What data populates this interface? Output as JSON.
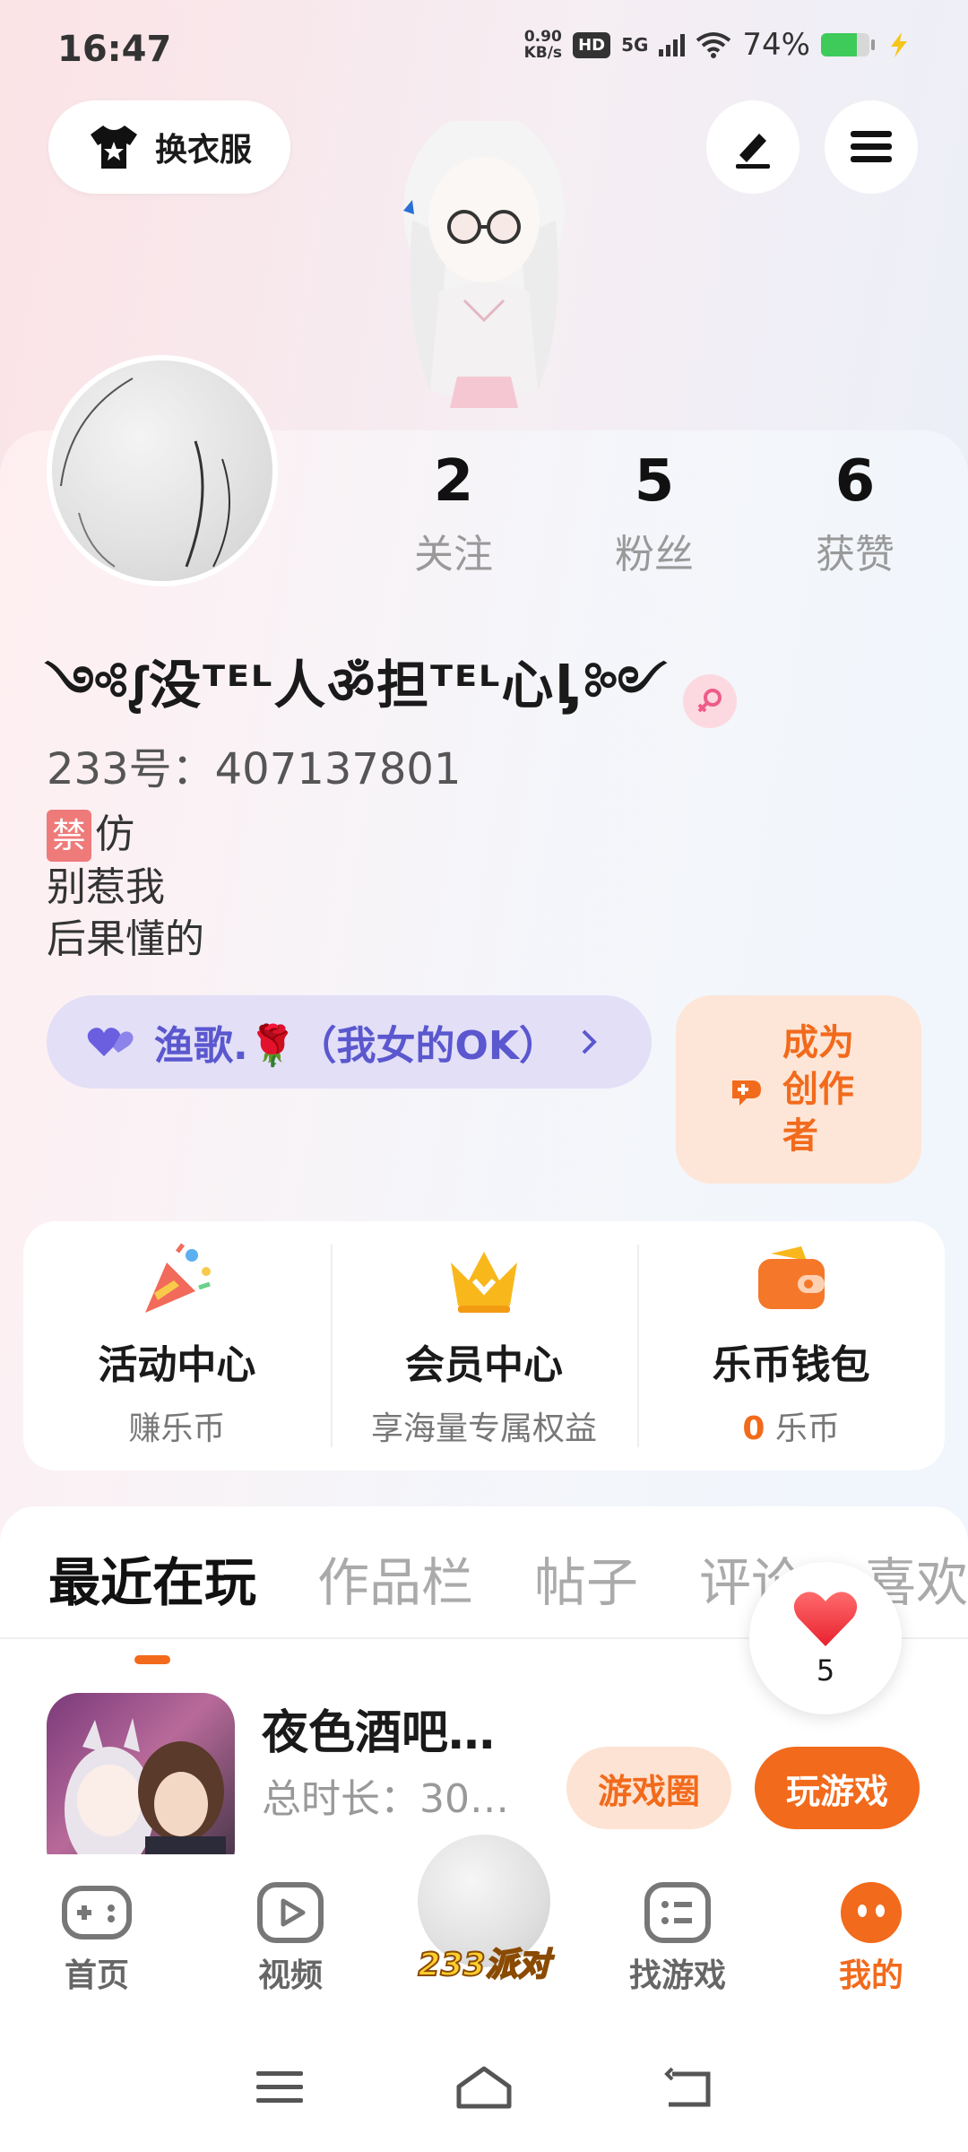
{
  "status_bar": {
    "time": "16:47",
    "speed_value": "0.90",
    "speed_unit": "KB/s",
    "hd": "HD",
    "network": "5G",
    "battery_percent": "74%",
    "battery_level": 0.74
  },
  "header": {
    "outfit_label": "换衣服"
  },
  "profile": {
    "stats": [
      {
        "value": "2",
        "label": "关注"
      },
      {
        "value": "5",
        "label": "粉丝"
      },
      {
        "value": "6",
        "label": "获赞"
      }
    ],
    "nickname": "༺ᶘ没ᵀᴱᴸ人ॐ担ᵀᴱᴸ心ᶅ༻",
    "uid": "233号：407137801",
    "bio_badge": "禁",
    "bio_lines": [
      "仿",
      "别惹我",
      "后果懂的"
    ]
  },
  "family": {
    "label": "渔歌.🌹（我女的OK）"
  },
  "creator": {
    "label": "成为创作者"
  },
  "services": [
    {
      "title": "活动中心",
      "sub": "赚乐币"
    },
    {
      "title": "会员中心",
      "sub": "享海量专属权益"
    },
    {
      "title": "乐币钱包",
      "sub_value": "0",
      "sub_unit": "乐币"
    }
  ],
  "tabs": [
    "最近在玩",
    "作品栏",
    "帖子",
    "评论",
    "喜欢"
  ],
  "like_bubble": {
    "count": "5"
  },
  "recent_game": {
    "title": "夜色酒吧…",
    "duration": "总时长：30…",
    "circle_btn": "游戏圈",
    "play_btn": "玩游戏"
  },
  "bottom_nav": [
    {
      "label": "首页"
    },
    {
      "label": "视频"
    },
    {
      "label": "233派对"
    },
    {
      "label": "找游戏"
    },
    {
      "label": "我的"
    }
  ],
  "colors": {
    "accent": "#f26a1b",
    "family_text": "#5a57cf"
  }
}
